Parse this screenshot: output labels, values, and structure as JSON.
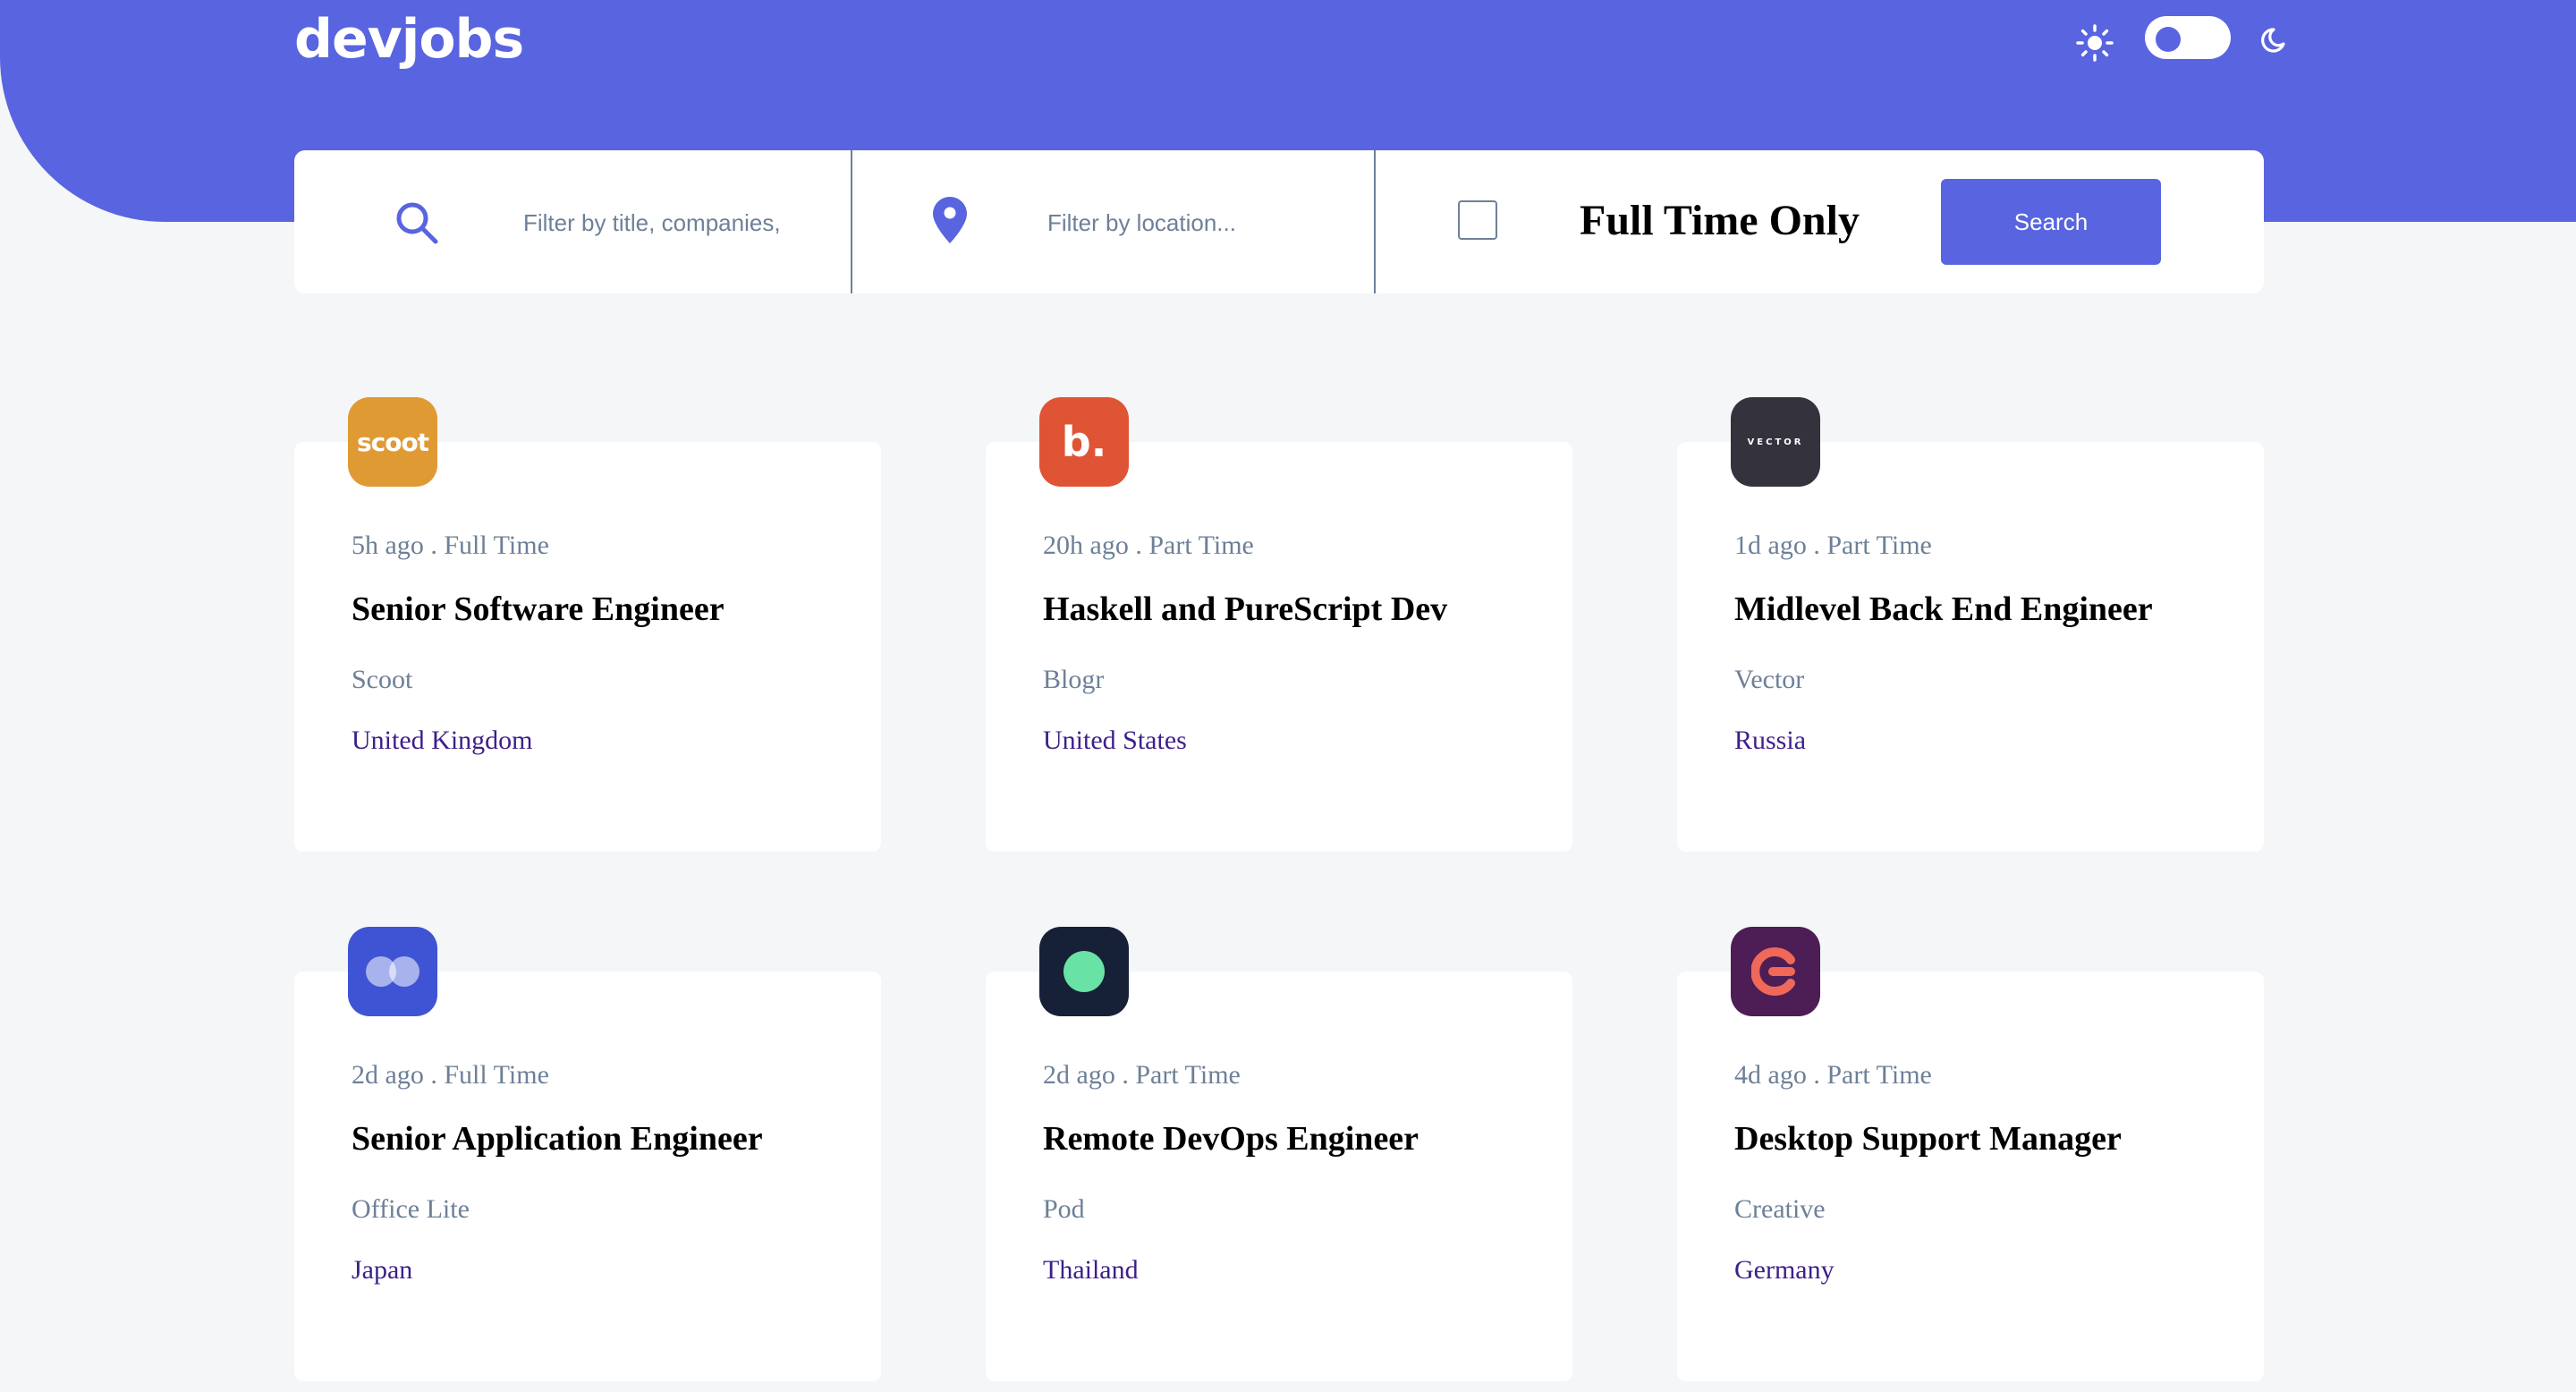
{
  "app": {
    "logo_text": "devjobs"
  },
  "theme": {
    "mode": "light"
  },
  "filters": {
    "title_placeholder": "Filter by title, companies, expertise...",
    "location_placeholder": "Filter by location...",
    "full_time_label": "Full Time Only",
    "full_time_checked": false,
    "search_label": "Search"
  },
  "colors": {
    "brand": "#5964e0",
    "background": "#f4f6f8",
    "location_text": "#3d1f8a"
  },
  "jobs": [
    {
      "posted": "5h ago",
      "contract": "Full Time",
      "title": "Senior Software Engineer",
      "company": "Scoot",
      "location": "United Kingdom",
      "logo_bg": "#e09a34",
      "logo_icon": "scoot-logo",
      "logo_text": "scoot"
    },
    {
      "posted": "20h ago",
      "contract": "Part Time",
      "title": "Haskell and PureScript Dev",
      "company": "Blogr",
      "location": "United States",
      "logo_bg": "#e05436",
      "logo_icon": "blogr-logo",
      "logo_text": "b."
    },
    {
      "posted": "1d ago",
      "contract": "Part Time",
      "title": "Midlevel Back End Engineer",
      "company": "Vector",
      "location": "Russia",
      "logo_bg": "#33323d",
      "logo_icon": "vector-logo",
      "logo_text": "VECTOR"
    },
    {
      "posted": "2d ago",
      "contract": "Full Time",
      "title": "Senior Application Engineer",
      "company": "Office Lite",
      "location": "Japan",
      "logo_bg": "#3e54d4",
      "logo_icon": "officelite-logo",
      "logo_text": ""
    },
    {
      "posted": "2d ago",
      "contract": "Part Time",
      "title": "Remote DevOps Engineer",
      "company": "Pod",
      "location": "Thailand",
      "logo_bg": "#162037",
      "logo_icon": "pod-logo",
      "logo_text": ""
    },
    {
      "posted": "4d ago",
      "contract": "Part Time",
      "title": "Desktop Support Manager",
      "company": "Creative",
      "location": "Germany",
      "logo_bg": "#4d1d55",
      "logo_icon": "creative-logo",
      "logo_text": ""
    }
  ]
}
